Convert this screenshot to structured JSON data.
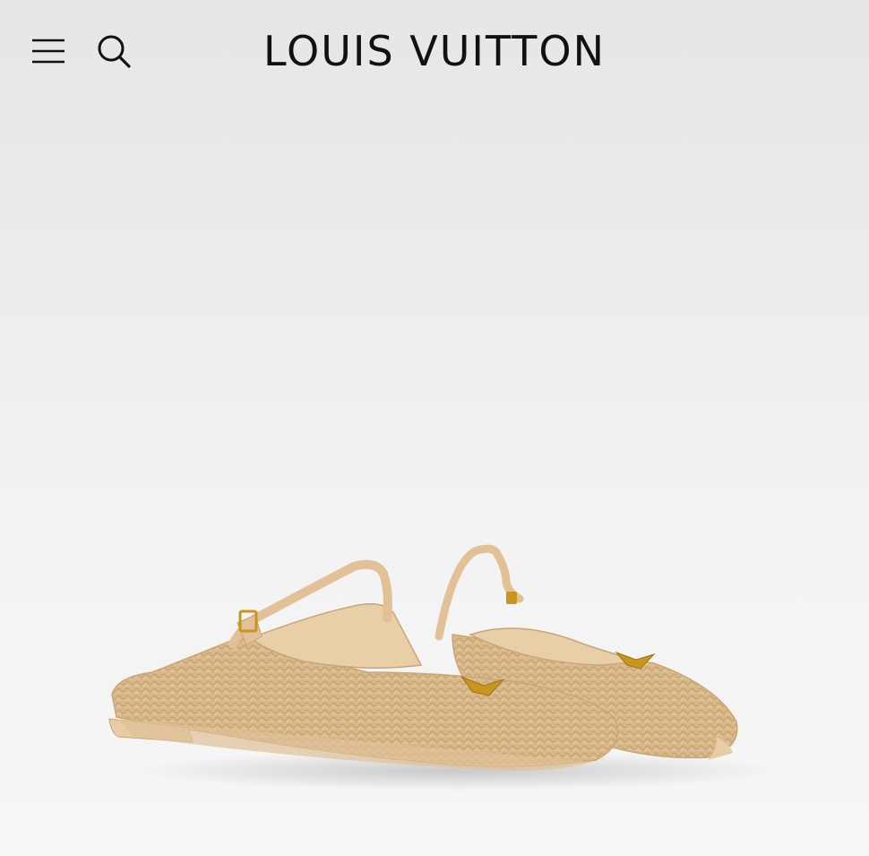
{
  "header": {
    "menu_icon": "hamburger-menu-icon",
    "search_icon": "search-icon",
    "brand_name": "LOUIS VUITTON"
  },
  "product": {
    "image_icon": "woven-raffia-mule-image",
    "colors": {
      "raffia": "#d9b88a",
      "leather": "#e8c9a0",
      "hardware": "#c8961e"
    }
  },
  "colors": {
    "text": "#111111",
    "background": "#f0f0f0"
  }
}
